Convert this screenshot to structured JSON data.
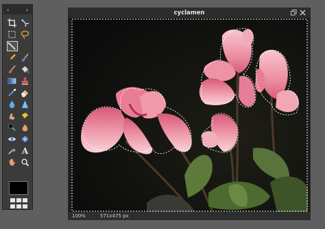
{
  "tools_panel": {
    "header_left": "‹",
    "header_right": "›",
    "tools": [
      {
        "name": "crop-tool-icon",
        "active": false
      },
      {
        "name": "slice-tool-icon",
        "active": false
      },
      {
        "name": "marquee-select-icon",
        "active": false
      },
      {
        "name": "lasso-select-icon",
        "active": false
      },
      {
        "name": "magic-wand-icon",
        "active": true
      },
      {
        "name": "empty-slot",
        "active": false
      },
      {
        "name": "pencil-icon",
        "active": false
      },
      {
        "name": "brush-icon",
        "active": false
      },
      {
        "name": "color-replace-icon",
        "active": false
      },
      {
        "name": "paint-bucket-icon",
        "active": false
      },
      {
        "name": "gradient-icon",
        "active": false
      },
      {
        "name": "clone-stamp-icon",
        "active": false
      },
      {
        "name": "wand-brush-icon",
        "active": false
      },
      {
        "name": "eraser-icon",
        "active": false
      },
      {
        "name": "blur-drop-icon",
        "active": false
      },
      {
        "name": "sharpen-icon",
        "active": false
      },
      {
        "name": "smudge-finger-icon",
        "active": false
      },
      {
        "name": "sponge-icon",
        "active": false
      },
      {
        "name": "dodge-icon",
        "active": false
      },
      {
        "name": "burn-icon",
        "active": false
      },
      {
        "name": "red-eye-icon",
        "active": false
      },
      {
        "name": "spot-heal-icon",
        "active": false
      },
      {
        "name": "color-picker-icon",
        "active": false
      },
      {
        "name": "text-tool-icon",
        "active": false
      },
      {
        "name": "hand-tool-icon",
        "active": false
      },
      {
        "name": "zoom-tool-icon",
        "active": false
      }
    ],
    "text_tool_glyph": "A",
    "primary_color": "#000000"
  },
  "image_window": {
    "title": "cyclamen",
    "zoom": "100",
    "zoom_unit": "%",
    "dimensions": "571x475 px"
  },
  "colors": {
    "petal_pink": "#e9859a",
    "petal_light": "#f6c3cc",
    "leaf_green": "#5d7a3a",
    "background": "#111111"
  }
}
